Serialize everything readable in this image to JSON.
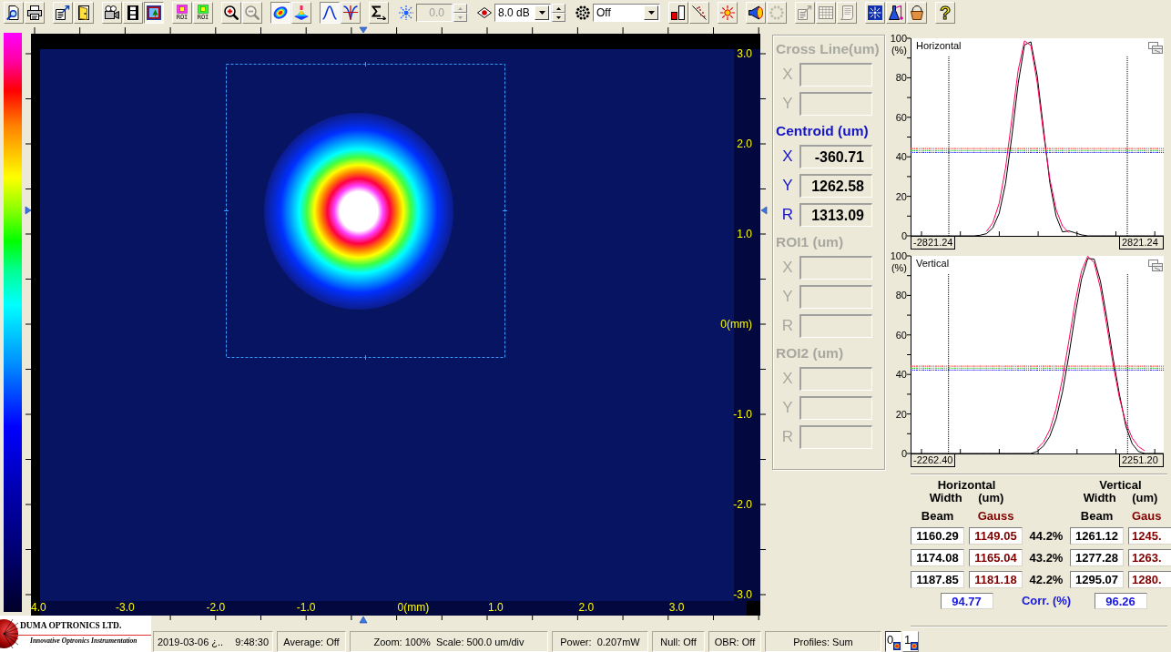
{
  "toolbar": {
    "groups": [
      [
        {
          "kind": "button",
          "pressed": false,
          "disabled": false
        },
        {
          "kind": "button",
          "pressed": false,
          "disabled": false
        }
      ],
      [
        {
          "kind": "button",
          "pressed": false,
          "disabled": false
        },
        {
          "kind": "button",
          "pressed": false,
          "disabled": false
        }
      ],
      [
        {
          "kind": "button",
          "pressed": false,
          "disabled": false
        },
        {
          "kind": "button",
          "pressed": false,
          "disabled": false
        },
        {
          "kind": "button",
          "pressed": true,
          "disabled": false
        }
      ],
      [
        {
          "kind": "button",
          "label": "ROI",
          "pressed": false,
          "disabled": false
        },
        {
          "kind": "button",
          "label": "ROI",
          "pressed": false,
          "disabled": false
        }
      ],
      [
        {
          "kind": "button",
          "pressed": false,
          "disabled": false
        },
        {
          "kind": "button",
          "pressed": false,
          "disabled": true
        }
      ],
      [
        {
          "kind": "button",
          "pressed": true,
          "disabled": false
        },
        {
          "kind": "button",
          "pressed": false,
          "disabled": false
        }
      ],
      [
        {
          "kind": "button",
          "pressed": true,
          "disabled": false
        },
        {
          "kind": "button",
          "pressed": false,
          "disabled": false
        }
      ],
      [
        {
          "kind": "button",
          "pressed": false,
          "disabled": false
        }
      ],
      [
        {
          "kind": "icon"
        },
        {
          "kind": "number_field",
          "value": "0.0",
          "disabled": true
        },
        {
          "kind": "spinner",
          "disabled": true
        }
      ],
      [
        {
          "kind": "icon"
        },
        {
          "kind": "dropdown",
          "value": "8.0 dB",
          "disabled": false
        },
        {
          "kind": "spinner",
          "disabled": false
        }
      ],
      [
        {
          "kind": "icon"
        },
        {
          "kind": "dropdown",
          "value": "Off",
          "disabled": false
        }
      ],
      [
        {
          "kind": "button",
          "pressed": false,
          "disabled": false
        },
        {
          "kind": "button",
          "pressed": false,
          "disabled": false
        }
      ],
      [
        {
          "kind": "button",
          "pressed": false,
          "disabled": false
        }
      ],
      [
        {
          "kind": "button",
          "pressed": false,
          "disabled": false
        },
        {
          "kind": "button",
          "pressed": false,
          "disabled": true
        }
      ],
      [
        {
          "kind": "button",
          "pressed": false,
          "disabled": true
        },
        {
          "kind": "button",
          "pressed": false,
          "disabled": true
        },
        {
          "kind": "button",
          "pressed": false,
          "disabled": true
        }
      ],
      [
        {
          "kind": "button",
          "pressed": false,
          "disabled": false
        },
        {
          "kind": "button",
          "pressed": false,
          "disabled": false
        },
        {
          "kind": "button",
          "pressed": false,
          "disabled": false
        }
      ],
      [
        {
          "kind": "button",
          "label": "?",
          "pressed": false,
          "disabled": false
        }
      ]
    ]
  },
  "beam_image": {
    "x_labels": [
      "4.0",
      "-3.0",
      "-2.0",
      "-1.0",
      "0(mm)",
      "1.0",
      "2.0",
      "3.0"
    ],
    "y_labels": [
      "3.0",
      "2.0",
      "1.0",
      "0(mm)",
      "-1.0",
      "-2.0",
      "-3.0"
    ]
  },
  "measurements": {
    "sections": [
      {
        "title": "Cross Line(um)",
        "disabled": true,
        "fields": [
          {
            "label": "X"
          },
          {
            "label": "Y"
          }
        ]
      },
      {
        "title": "Centroid (um)",
        "disabled": false,
        "fields": [
          {
            "label": "X",
            "value": "-360.71"
          },
          {
            "label": "Y",
            "value": "1262.58"
          },
          {
            "label": "R",
            "value": "1313.09"
          }
        ]
      },
      {
        "title": "ROI1 (um)",
        "disabled": true,
        "fields": [
          {
            "label": "X"
          },
          {
            "label": "Y"
          },
          {
            "label": "R"
          }
        ]
      },
      {
        "title": "ROI2 (um)",
        "disabled": true,
        "fields": [
          {
            "label": "X"
          },
          {
            "label": "Y"
          },
          {
            "label": "R"
          }
        ]
      }
    ]
  },
  "profiles": [
    {
      "chart_data": {
        "type": "line",
        "title": "Horizontal",
        "ylabel": "(%)",
        "categories": [
          null,
          null,
          null,
          null,
          null,
          null,
          null,
          null,
          null,
          null,
          null,
          null,
          null,
          null,
          null,
          null,
          null,
          null,
          null,
          null,
          null,
          null,
          null,
          null,
          null,
          null,
          null,
          null,
          null,
          null,
          null,
          null,
          null,
          null,
          null,
          null,
          null,
          null,
          null,
          null,
          null
        ],
        "series": [
          {
            "color": "#000000",
            "values": [
              0,
              0,
              0,
              0,
              0,
              0,
              0,
              0,
              0,
              0,
              0,
              0.3,
              1.1,
              4.0,
              11.4,
              26.5,
              50.2,
              77.2,
              96.6,
              98.2,
              81.2,
              54.6,
              27.0,
              10.0,
              2.0,
              2.5,
              1.5,
              0.5,
              0,
              0,
              0,
              0,
              0,
              0,
              0,
              0,
              0,
              0,
              0,
              0,
              0
            ]
          },
          {
            "color": "#ff0060",
            "values": [
              null,
              null,
              null,
              null,
              null,
              null,
              null,
              null,
              null,
              null,
              null,
              null,
              2.2,
              6.6,
              16.5,
              34.3,
              58.9,
              83.8,
              98.7,
              96.3,
              77.8,
              52.1,
              28.9,
              13.3,
              5.0,
              1.6,
              null,
              null,
              null,
              null,
              null,
              null,
              null,
              null,
              null,
              null,
              null,
              null,
              null,
              null,
              null
            ]
          },
          {
            "color": "#ff0000",
            "line_style": "dotted",
            "values": [
              44.2,
              44.2,
              44.2,
              44.2,
              44.2,
              44.2,
              44.2,
              44.2,
              44.2,
              44.2,
              44.2,
              44.2,
              44.2,
              44.2,
              44.2,
              44.2,
              44.2,
              44.2,
              44.2,
              44.2,
              44.2,
              44.2,
              44.2,
              44.2,
              44.2,
              44.2,
              44.2,
              44.2,
              44.2,
              44.2,
              44.2,
              44.2,
              44.2,
              44.2,
              44.2,
              44.2,
              44.2,
              44.2,
              44.2,
              44.2,
              44.2
            ]
          },
          {
            "color": "#00b000",
            "line_style": "dotted",
            "values": [
              43.2,
              43.2,
              43.2,
              43.2,
              43.2,
              43.2,
              43.2,
              43.2,
              43.2,
              43.2,
              43.2,
              43.2,
              43.2,
              43.2,
              43.2,
              43.2,
              43.2,
              43.2,
              43.2,
              43.2,
              43.2,
              43.2,
              43.2,
              43.2,
              43.2,
              43.2,
              43.2,
              43.2,
              43.2,
              43.2,
              43.2,
              43.2,
              43.2,
              43.2,
              43.2,
              43.2,
              43.2,
              43.2,
              43.2,
              43.2,
              43.2
            ]
          },
          {
            "color": "#0000ff",
            "line_style": "dotted",
            "values": [
              42.2,
              42.2,
              42.2,
              42.2,
              42.2,
              42.2,
              42.2,
              42.2,
              42.2,
              42.2,
              42.2,
              42.2,
              42.2,
              42.2,
              42.2,
              42.2,
              42.2,
              42.2,
              42.2,
              42.2,
              42.2,
              42.2,
              42.2,
              42.2,
              42.2,
              42.2,
              42.2,
              42.2,
              42.2,
              42.2,
              42.2,
              42.2,
              42.2,
              42.2,
              42.2,
              42.2,
              42.2,
              42.2,
              42.2,
              42.2,
              42.2
            ]
          }
        ],
        "ylim": [
          0,
          100
        ],
        "yticks": [
          0,
          20,
          40,
          60,
          80,
          100
        ]
      },
      "range_labels": [
        "-2821.24",
        "2821.24"
      ]
    },
    {
      "chart_data": {
        "type": "line",
        "title": "Vertical",
        "ylabel": "(%)",
        "categories": [
          null,
          null,
          null,
          null,
          null,
          null,
          null,
          null,
          null,
          null,
          null,
          null,
          null,
          null,
          null,
          null,
          null,
          null,
          null,
          null,
          null,
          null,
          null,
          null,
          null,
          null,
          null,
          null,
          null,
          null,
          null,
          null,
          null,
          null,
          null,
          null,
          null,
          null,
          null,
          null,
          null
        ],
        "series": [
          {
            "color": "#000000",
            "values": [
              0,
              0,
              0,
              0,
              0,
              0,
              0,
              0,
              0,
              0,
              0,
              0,
              0,
              0,
              0,
              0,
              0,
              0,
              0,
              0,
              1.0,
              3.8,
              8.7,
              17.4,
              31.1,
              49.5,
              70.0,
              88.2,
              98.7,
              98.4,
              87.2,
              68.8,
              48.2,
              30.1,
              14.0,
              5.0,
              1.0,
              0,
              0,
              0,
              0
            ]
          },
          {
            "color": "#ff0060",
            "values": [
              null,
              null,
              null,
              null,
              null,
              null,
              null,
              null,
              null,
              null,
              null,
              null,
              null,
              null,
              null,
              null,
              null,
              null,
              null,
              null,
              2.5,
              5.7,
              12.0,
              22.5,
              37.8,
              56.8,
              76.5,
              92.3,
              99.8,
              96.6,
              83.7,
              65.0,
              45.2,
              28.2,
              15.7,
              7.9,
              3.5,
              1.4,
              null,
              null,
              null
            ]
          },
          {
            "color": "#ff0000",
            "line_style": "dotted",
            "values": [
              44.2,
              44.2,
              44.2,
              44.2,
              44.2,
              44.2,
              44.2,
              44.2,
              44.2,
              44.2,
              44.2,
              44.2,
              44.2,
              44.2,
              44.2,
              44.2,
              44.2,
              44.2,
              44.2,
              44.2,
              44.2,
              44.2,
              44.2,
              44.2,
              44.2,
              44.2,
              44.2,
              44.2,
              44.2,
              44.2,
              44.2,
              44.2,
              44.2,
              44.2,
              44.2,
              44.2,
              44.2,
              44.2,
              44.2,
              44.2,
              44.2
            ]
          },
          {
            "color": "#00b000",
            "line_style": "dotted",
            "values": [
              43.2,
              43.2,
              43.2,
              43.2,
              43.2,
              43.2,
              43.2,
              43.2,
              43.2,
              43.2,
              43.2,
              43.2,
              43.2,
              43.2,
              43.2,
              43.2,
              43.2,
              43.2,
              43.2,
              43.2,
              43.2,
              43.2,
              43.2,
              43.2,
              43.2,
              43.2,
              43.2,
              43.2,
              43.2,
              43.2,
              43.2,
              43.2,
              43.2,
              43.2,
              43.2,
              43.2,
              43.2,
              43.2,
              43.2,
              43.2,
              43.2
            ]
          },
          {
            "color": "#0000ff",
            "line_style": "dotted",
            "values": [
              42.2,
              42.2,
              42.2,
              42.2,
              42.2,
              42.2,
              42.2,
              42.2,
              42.2,
              42.2,
              42.2,
              42.2,
              42.2,
              42.2,
              42.2,
              42.2,
              42.2,
              42.2,
              42.2,
              42.2,
              42.2,
              42.2,
              42.2,
              42.2,
              42.2,
              42.2,
              42.2,
              42.2,
              42.2,
              42.2,
              42.2,
              42.2,
              42.2,
              42.2,
              42.2,
              42.2,
              42.2,
              42.2,
              42.2,
              42.2,
              42.2
            ]
          }
        ],
        "ylim": [
          0,
          100
        ],
        "yticks": [
          0,
          20,
          40,
          60,
          80,
          100
        ]
      },
      "range_labels": [
        "-2262.40",
        "2251.20"
      ]
    }
  ],
  "width_table": {
    "groups": [
      {
        "title": "Horizontal",
        "subtitle": "Width (um)"
      },
      {
        "title": "Vertical",
        "subtitle": "Width (um)"
      }
    ],
    "columns": [
      {
        "label": "Beam",
        "kind": "beam"
      },
      {
        "label": "Gauss",
        "kind": "gauss"
      },
      {
        "label": "Beam",
        "kind": "beam"
      },
      {
        "label": "Gaus",
        "kind": "gauss"
      }
    ],
    "rows": [
      {
        "clip": "44.2%",
        "values": [
          "1160.29",
          "1149.05",
          "1261.12",
          "1245."
        ]
      },
      {
        "clip": "43.2%",
        "values": [
          "1174.08",
          "1165.04",
          "1277.28",
          "1263."
        ]
      },
      {
        "clip": "42.2%",
        "values": [
          "1187.85",
          "1181.18",
          "1295.07",
          "1280."
        ]
      }
    ],
    "correlation": {
      "label": "Corr. (%)",
      "values": [
        "94.77",
        "96.26"
      ]
    }
  },
  "status_bar": {
    "logo": {
      "name": "DUMA OPTRONICS LTD.",
      "tagline": "Innovative Optronics Instrumentation"
    },
    "panes": [
      {
        "texts": [
          "2019-03-06 ¿..",
          "9:48:30"
        ]
      },
      {
        "texts": [
          "Average: Off"
        ]
      },
      {
        "texts": [
          "Zoom: 100%  Scale: 500.0 um/div"
        ]
      },
      {
        "texts": [
          "Power:  0.207mW"
        ]
      },
      {
        "texts": [
          "Null: Off"
        ]
      },
      {
        "texts": [
          "OBR: Off"
        ]
      },
      {
        "texts": [
          "Profiles: Sum"
        ]
      }
    ],
    "cameras": [
      {
        "label": "0",
        "selected": true
      },
      {
        "label": "1",
        "selected": false
      }
    ]
  }
}
